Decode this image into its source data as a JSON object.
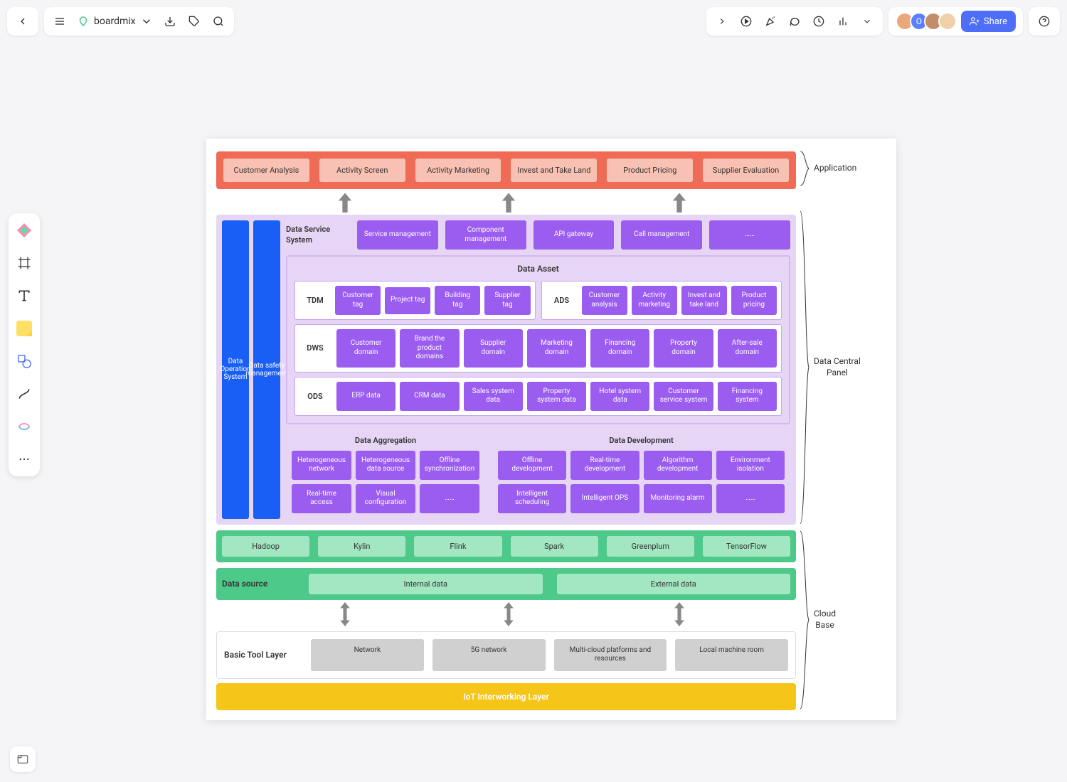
{
  "topbar": {
    "brand": "boardmix",
    "share_label": "Share"
  },
  "diagram": {
    "brackets": {
      "application": "Application",
      "data_central_panel": "Data Central\nPanel",
      "cloud_base": "Cloud\nBase"
    },
    "application": {
      "items": [
        "Customer Analysis",
        "Activity Screen",
        "Activity Marketing",
        "Invest and Take Land",
        "Product Pricing",
        "Supplier Evaluation"
      ]
    },
    "pillars": [
      "Data Operation System",
      "Data safety management"
    ],
    "data_service_system": {
      "label": "Data Service System",
      "items": [
        "Service management",
        "Component management",
        "API gateway",
        "Call management",
        "……"
      ]
    },
    "data_asset": {
      "title": "Data Asset",
      "tdm": {
        "label": "TDM",
        "items": [
          "Customer tag",
          "Project tag",
          "Building tag",
          "Supplier tag"
        ]
      },
      "ads": {
        "label": "ADS",
        "items": [
          "Customer analysis",
          "Activity marketing",
          "Invest and take land",
          "Product pricing"
        ]
      },
      "dws": {
        "label": "DWS",
        "items": [
          "Customer domain",
          "Brand the product domains",
          "Supplier domain",
          "Marketing domain",
          "Financing domain",
          "Property domain",
          "After-sale domain"
        ]
      },
      "ods": {
        "label": "ODS",
        "items": [
          "ERP data",
          "CRM data",
          "Sales system data",
          "Property system data",
          "Hotel system data",
          "Customer service system",
          "Financing system"
        ]
      }
    },
    "data_aggregation": {
      "title": "Data Aggregation",
      "items": [
        "Heterogeneous network",
        "Heterogeneous data source",
        "Offline synchronization",
        "Real-time access",
        "Visual configuration",
        "……"
      ]
    },
    "data_development": {
      "title": "Data Development",
      "items": [
        "Offline development",
        "Real-time development",
        "Algorithm development",
        "Environment isolation",
        "Intelligent scheduling",
        "Intelligent OPS",
        "Monitoring alarm",
        "……"
      ]
    },
    "tech_row": [
      "Hadoop",
      "Kylin",
      "Flink",
      "Spark",
      "Greenplum",
      "TensorFlow"
    ],
    "data_source": {
      "label": "Data source",
      "items": [
        "Internal data",
        "External data"
      ]
    },
    "basic_tool": {
      "label": "Basic Tool Layer",
      "items": [
        "Network",
        "5G network",
        "Multi-cloud platforms and resources",
        "Local machine room"
      ]
    },
    "iot_layer": "IoT Interworking Layer"
  }
}
